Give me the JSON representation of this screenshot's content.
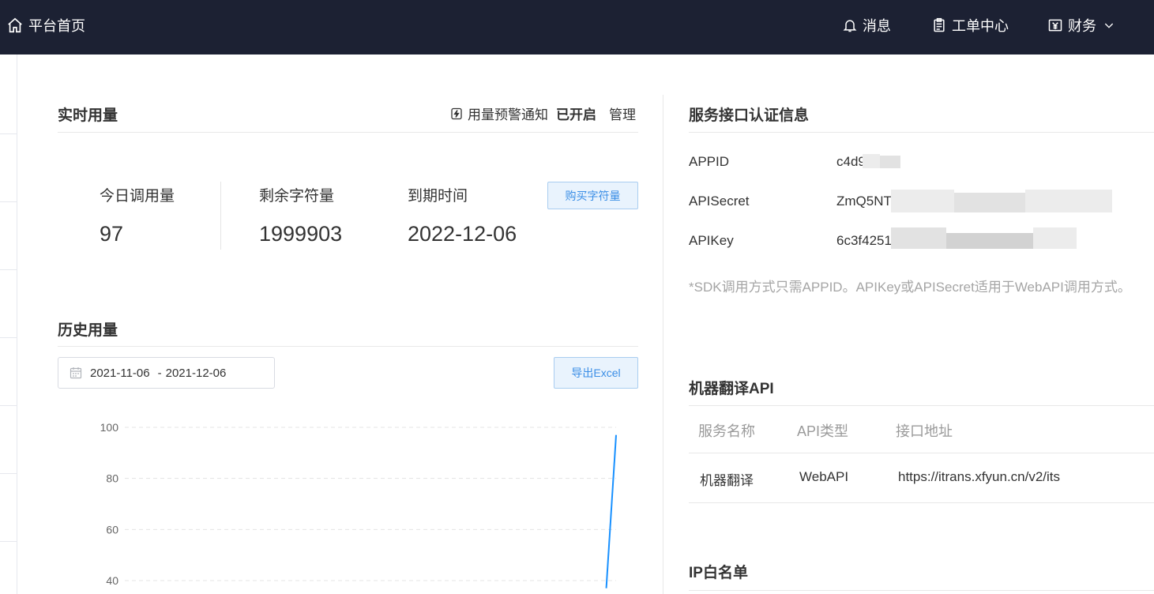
{
  "topbar": {
    "home_label": "平台首页",
    "nav": [
      {
        "icon": "bell-icon",
        "label": "消息"
      },
      {
        "icon": "clipboard-icon",
        "label": "工单中心"
      },
      {
        "icon": "yen-icon",
        "label": "财务"
      }
    ]
  },
  "realtime": {
    "title": "实时用量",
    "alert_label": "用量预警通知",
    "alert_status": "已开启",
    "manage_label": "管理",
    "stats": [
      {
        "label": "今日调用量",
        "value": "97"
      },
      {
        "label": "剩余字符量",
        "value": "1999903"
      },
      {
        "label": "到期时间",
        "value": "2022-12-06"
      }
    ],
    "buy_button": "购买字符量"
  },
  "history": {
    "title": "历史用量",
    "date_start": "2021-11-06",
    "date_sep": "-",
    "date_end": "2021-12-06",
    "export_button": "导出Excel"
  },
  "chart_data": {
    "type": "line",
    "title": "",
    "xlabel": "",
    "ylabel": "",
    "ylim": [
      30,
      100
    ],
    "y_ticks": [
      100,
      80,
      60,
      40
    ],
    "grid": true,
    "series": [
      {
        "color": "#1890ff",
        "points": [
          [
            0.98,
            37
          ],
          [
            1.0,
            97
          ]
        ]
      }
    ]
  },
  "auth": {
    "title": "服务接口认证信息",
    "rows": [
      {
        "label": "APPID",
        "value_visible": "c4d9"
      },
      {
        "label": "APISecret",
        "value_visible": "ZmQ5NT"
      },
      {
        "label": "APIKey",
        "value_visible": "6c3f4251"
      }
    ],
    "note": "*SDK调用方式只需APPID。APIKey或APISecret适用于WebAPI调用方式。"
  },
  "mt_api": {
    "title": "机器翻译API",
    "headers": [
      "服务名称",
      "API类型",
      "接口地址"
    ],
    "rows": [
      {
        "name": "机器翻译",
        "type": "WebAPI",
        "url": "https://itrans.xfyun.cn/v2/its"
      }
    ]
  },
  "ip_whitelist": {
    "title": "IP白名单"
  },
  "colors": {
    "topbar_bg": "#1c2133",
    "accent": "#3a8ee6",
    "line": "#1890ff"
  }
}
